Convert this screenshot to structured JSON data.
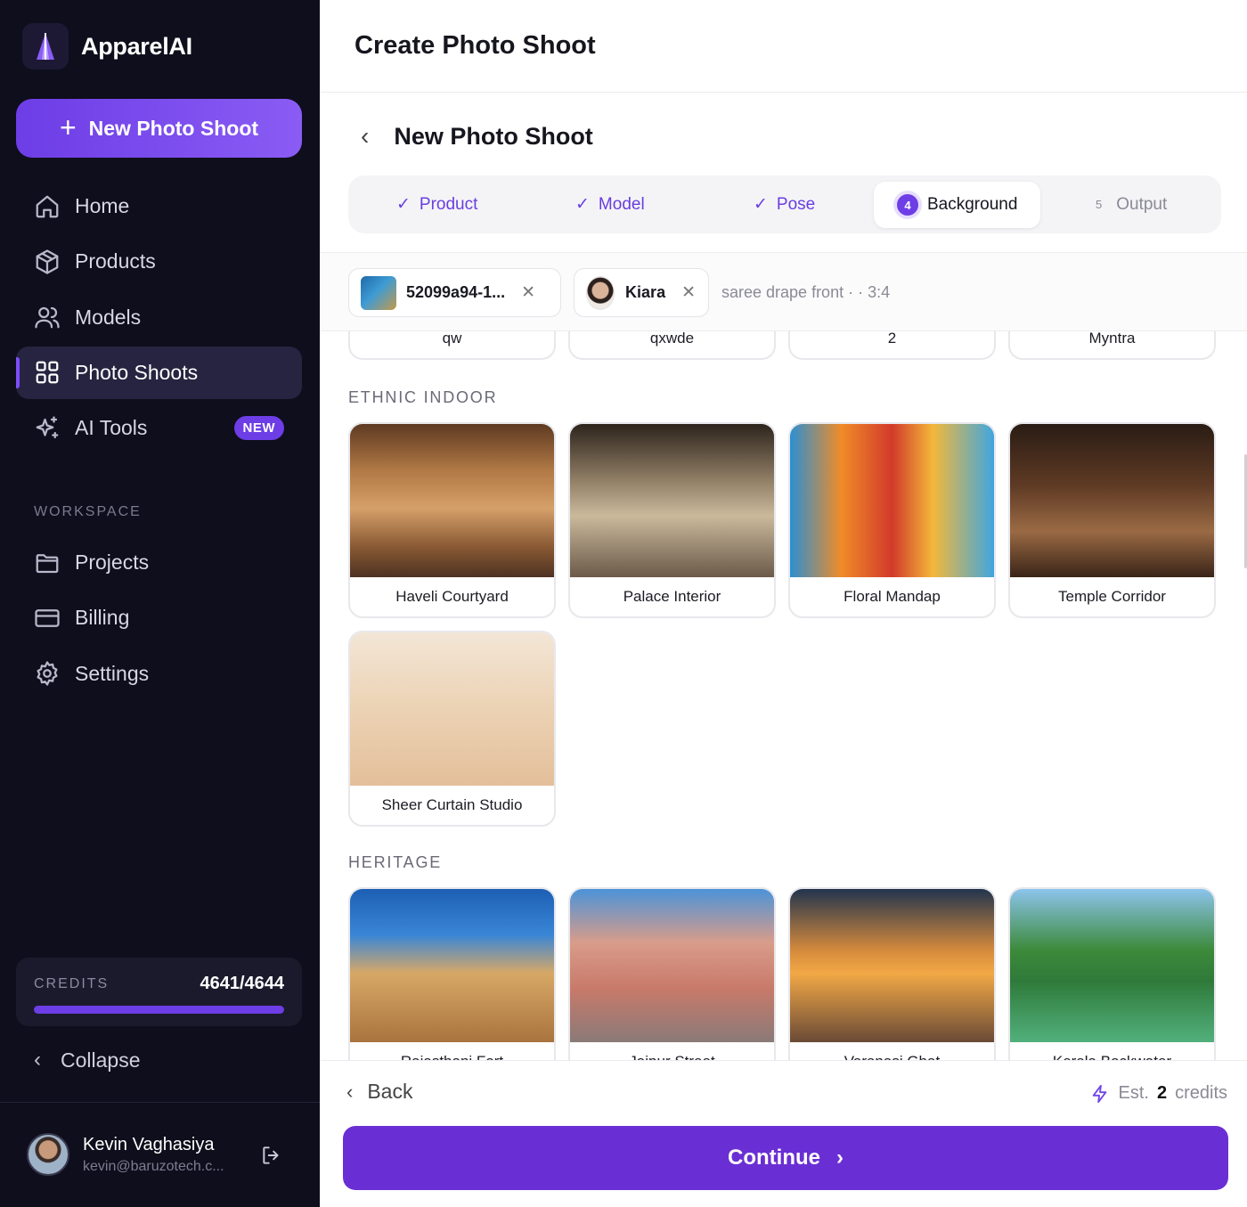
{
  "app": {
    "name": "ApparelAI"
  },
  "sidebar": {
    "new_button": "New Photo Shoot",
    "nav": [
      {
        "label": "Home",
        "icon": "home-icon"
      },
      {
        "label": "Products",
        "icon": "box-icon"
      },
      {
        "label": "Models",
        "icon": "users-icon"
      },
      {
        "label": "Photo Shoots",
        "icon": "grid-icon",
        "active": true
      },
      {
        "label": "AI Tools",
        "icon": "sparkles-icon",
        "badge": "NEW"
      }
    ],
    "workspace_label": "WORKSPACE",
    "workspace": [
      {
        "label": "Projects",
        "icon": "folder-icon"
      },
      {
        "label": "Billing",
        "icon": "credit-card-icon"
      },
      {
        "label": "Settings",
        "icon": "gear-icon"
      }
    ],
    "credits": {
      "label": "CREDITS",
      "value": "4641/4644",
      "fraction": 0.9994
    },
    "collapse_label": "Collapse",
    "user": {
      "name": "Kevin Vaghasiya",
      "email": "kevin@baruzotech.c..."
    }
  },
  "header": {
    "title": "Create Photo Shoot"
  },
  "wizard": {
    "title": "New Photo Shoot",
    "steps": [
      {
        "label": "Product",
        "state": "done"
      },
      {
        "label": "Model",
        "state": "done"
      },
      {
        "label": "Pose",
        "state": "done"
      },
      {
        "label": "Background",
        "state": "current",
        "number": "4"
      },
      {
        "label": "Output",
        "state": "todo",
        "number": "5"
      }
    ],
    "chips": {
      "product": "52099a94-1...",
      "model": "Kiara",
      "meta": "saree drape front · · 3:4"
    }
  },
  "backgrounds": {
    "previous_row": [
      "qw",
      "qxwde",
      "2",
      "Myntra"
    ],
    "groups": [
      {
        "label": "ETHNIC INDOOR",
        "items": [
          "Haveli Courtyard",
          "Palace Interior",
          "Floral Mandap",
          "Temple Corridor",
          "Sheer Curtain Studio"
        ]
      },
      {
        "label": "HERITAGE",
        "items": [
          "Rajasthani Fort",
          "Jaipur Street",
          "Varanasi Ghat",
          "Kerala Backwater"
        ]
      }
    ]
  },
  "footer": {
    "back_label": "Back",
    "estimate_prefix": "Est.",
    "estimate_value": "2",
    "estimate_suffix": "credits",
    "continue_label": "Continue"
  },
  "colors": {
    "accent": "#6d3de6",
    "sidebar_bg": "#0e0e1c",
    "continue_bg": "#6a2fd4"
  }
}
